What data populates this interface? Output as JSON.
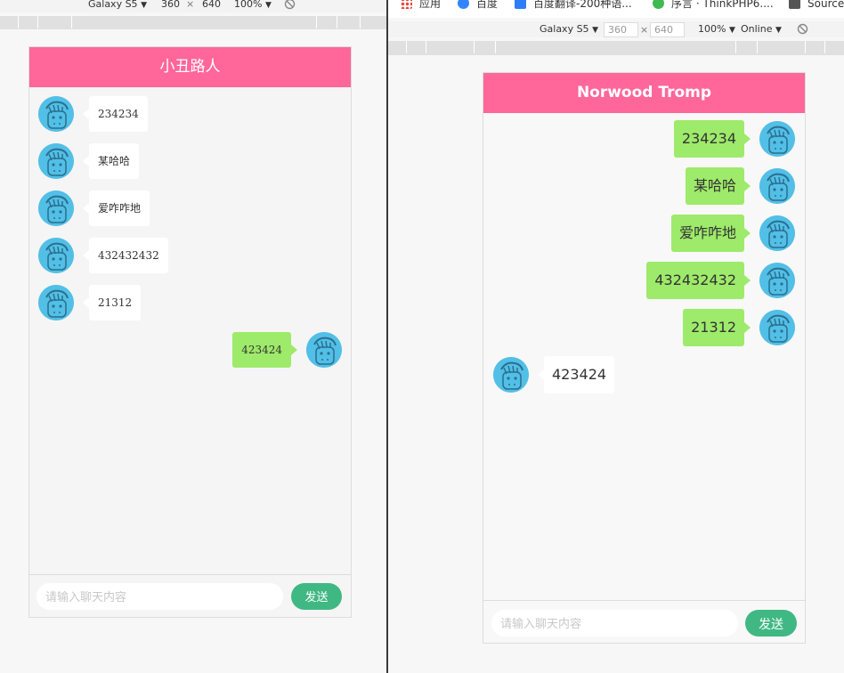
{
  "left_window": {
    "device_toolbar": {
      "device": "Galaxy S5",
      "width": "360",
      "times": "×",
      "height": "640",
      "zoom": "100%",
      "arrow": "▼"
    },
    "chat": {
      "title": "小丑路人",
      "messages": [
        {
          "text": "234234",
          "side": "left"
        },
        {
          "text": "某哈哈",
          "side": "left"
        },
        {
          "text": "爱咋咋地",
          "side": "left"
        },
        {
          "text": "432432432",
          "side": "left"
        },
        {
          "text": "21312",
          "side": "left"
        },
        {
          "text": "423424",
          "side": "right"
        }
      ],
      "input_placeholder": "请输入聊天内容",
      "send_label": "发送"
    }
  },
  "right_window": {
    "bookmarks": [
      {
        "label": "应用",
        "icon": "apps-grid-icon"
      },
      {
        "label": "百度",
        "icon": "baidu-paw-icon"
      },
      {
        "label": "百度翻译-200种语...",
        "icon": "baidu-translate-icon"
      },
      {
        "label": "序言 · ThinkPHP6....",
        "icon": "thinkphp-icon"
      },
      {
        "label": "Source",
        "icon": "source-icon"
      }
    ],
    "device_toolbar": {
      "device": "Galaxy S5",
      "width": "360",
      "times": "×",
      "height": "640",
      "zoom": "100%",
      "throttle": "Online",
      "arrow": "▼"
    },
    "chat": {
      "title": "Norwood Tromp",
      "messages": [
        {
          "text": "234234",
          "side": "right"
        },
        {
          "text": "某哈哈",
          "side": "right"
        },
        {
          "text": "爱咋咋地",
          "side": "right"
        },
        {
          "text": "432432432",
          "side": "right"
        },
        {
          "text": "21312",
          "side": "right"
        },
        {
          "text": "423424",
          "side": "left"
        }
      ],
      "input_placeholder": "请输入聊天内容",
      "send_label": "发送"
    }
  },
  "colors": {
    "header": "#ff6699",
    "self_bubble": "#9eea6a",
    "send_button": "#40b883",
    "avatar": "#52bfe6"
  }
}
